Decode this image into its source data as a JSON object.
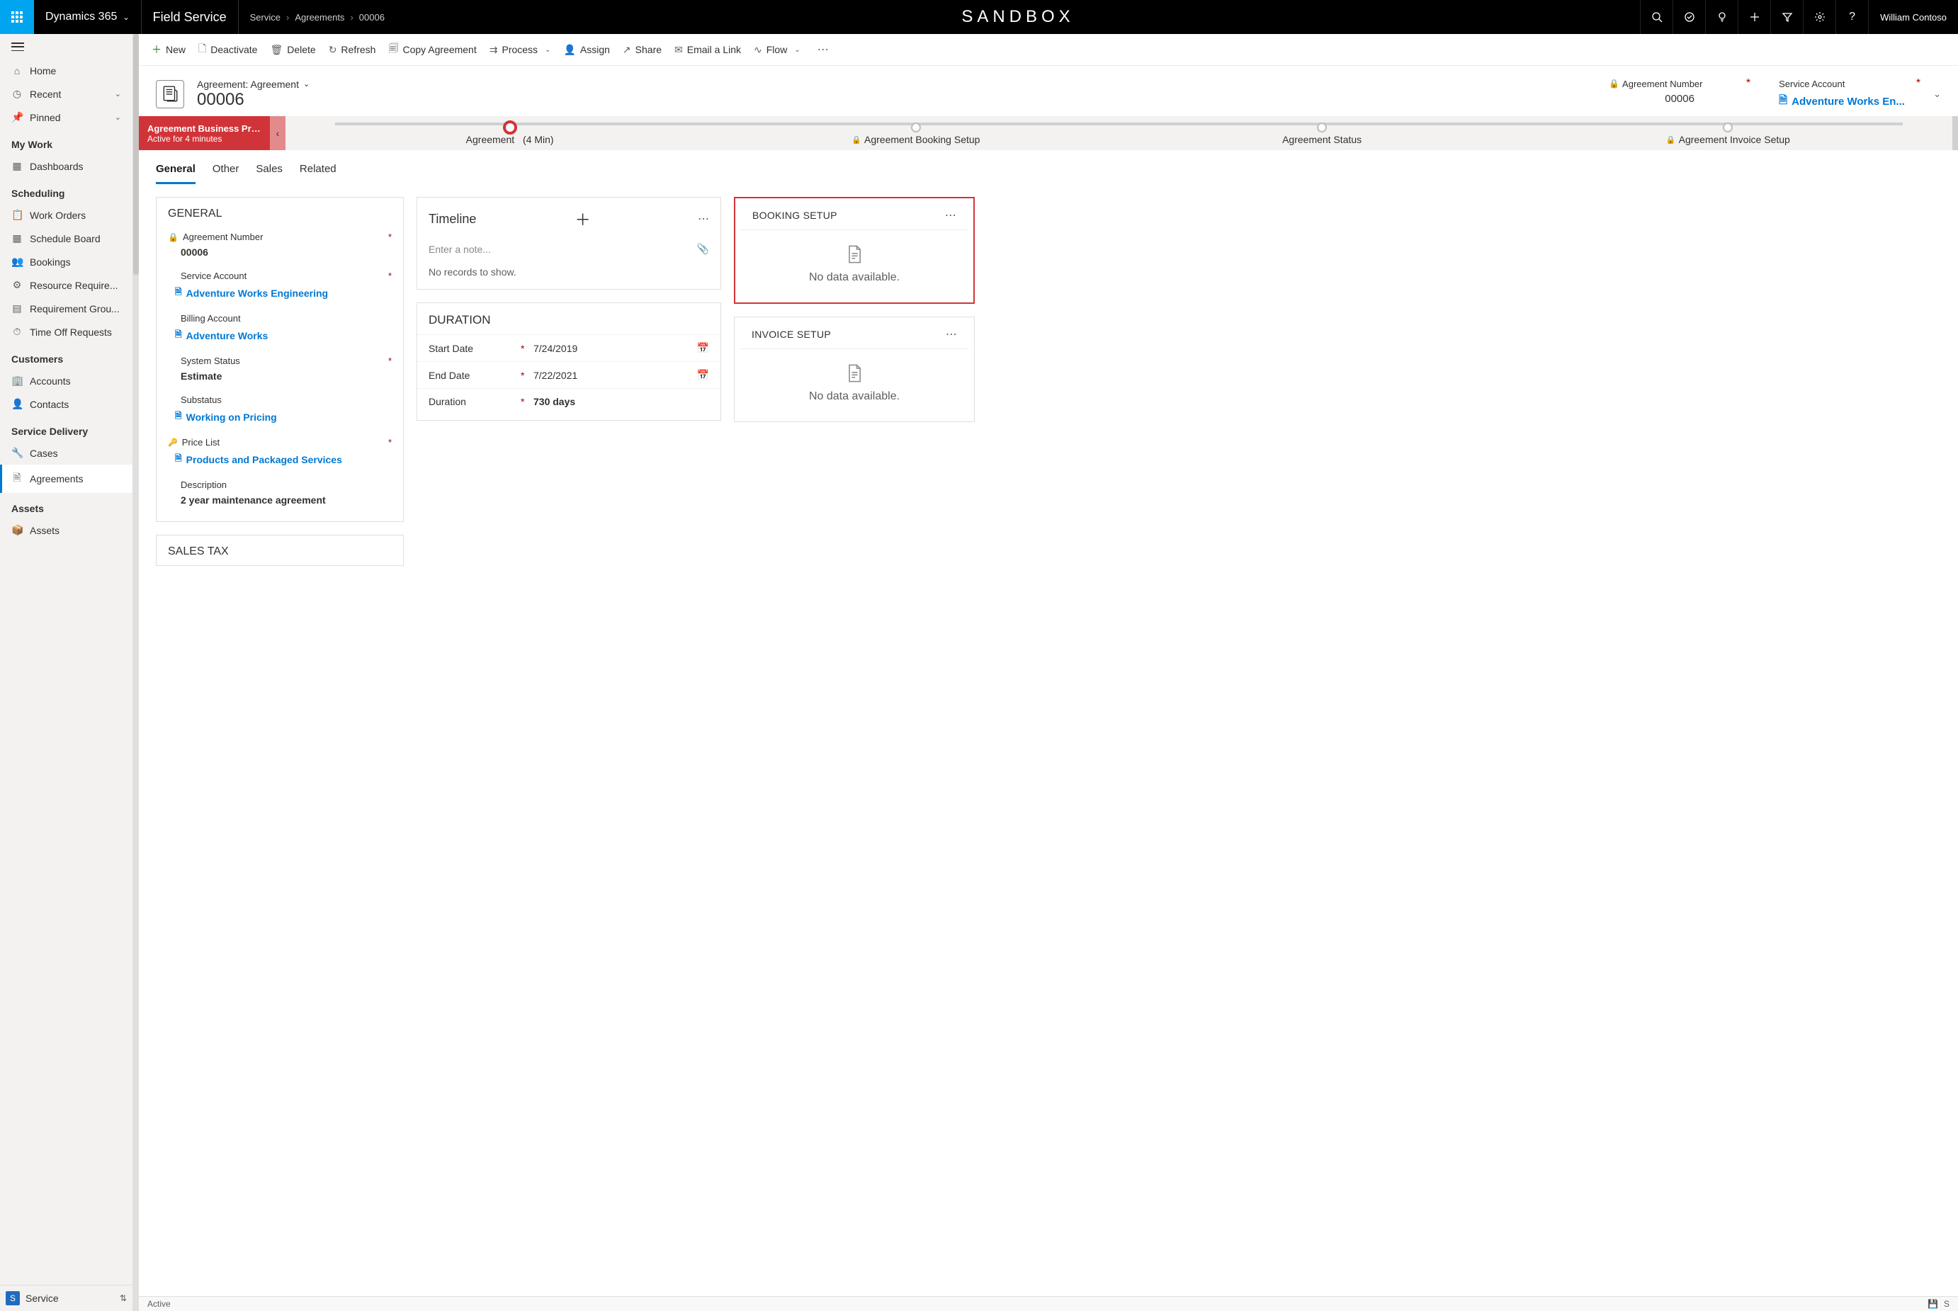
{
  "topbar": {
    "brand": "Dynamics 365",
    "area": "Field Service",
    "crumbs": [
      "Service",
      "Agreements",
      "00006"
    ],
    "sandbox": "SANDBOX",
    "user": "William Contoso"
  },
  "sidebar": {
    "items": [
      {
        "icon": "home",
        "label": "Home"
      },
      {
        "icon": "clock",
        "label": "Recent",
        "chev": true
      },
      {
        "icon": "pin",
        "label": "Pinned",
        "chev": true
      }
    ],
    "groups": [
      {
        "title": "My Work",
        "items": [
          {
            "icon": "dash",
            "label": "Dashboards"
          }
        ]
      },
      {
        "title": "Scheduling",
        "items": [
          {
            "icon": "clip",
            "label": "Work Orders"
          },
          {
            "icon": "cal",
            "label": "Schedule Board"
          },
          {
            "icon": "people",
            "label": "Bookings"
          },
          {
            "icon": "gear",
            "label": "Resource Require..."
          },
          {
            "icon": "grid",
            "label": "Requirement Grou..."
          },
          {
            "icon": "timeoff",
            "label": "Time Off Requests"
          }
        ]
      },
      {
        "title": "Customers",
        "items": [
          {
            "icon": "building",
            "label": "Accounts"
          },
          {
            "icon": "person",
            "label": "Contacts"
          }
        ]
      },
      {
        "title": "Service Delivery",
        "items": [
          {
            "icon": "wrench",
            "label": "Cases"
          },
          {
            "icon": "doc",
            "label": "Agreements",
            "active": true
          }
        ]
      },
      {
        "title": "Assets",
        "items": [
          {
            "icon": "cube",
            "label": "Assets"
          }
        ]
      }
    ],
    "area": {
      "letter": "S",
      "label": "Service"
    }
  },
  "cmdbar": [
    {
      "icon": "plus",
      "label": "New",
      "green": true
    },
    {
      "icon": "deact",
      "label": "Deactivate"
    },
    {
      "icon": "trash",
      "label": "Delete"
    },
    {
      "icon": "refresh",
      "label": "Refresh"
    },
    {
      "icon": "copy",
      "label": "Copy Agreement"
    },
    {
      "icon": "process",
      "label": "Process",
      "chev": true
    },
    {
      "icon": "assign",
      "label": "Assign"
    },
    {
      "icon": "share",
      "label": "Share"
    },
    {
      "icon": "email",
      "label": "Email a Link"
    },
    {
      "icon": "flow",
      "label": "Flow",
      "chev": true
    }
  ],
  "header": {
    "type": "Agreement: Agreement",
    "title": "00006",
    "fields": [
      {
        "label": "Agreement Number",
        "value": "00006",
        "lock": true,
        "req": true
      },
      {
        "label": "Service Account",
        "value": "Adventure Works En...",
        "link": true,
        "req": true
      }
    ]
  },
  "stagebar": {
    "name": "Agreement Business Pro...",
    "sub": "Active for 4 minutes",
    "stages": [
      {
        "label": "Agreement",
        "time": "(4 Min)",
        "active": true
      },
      {
        "label": "Agreement Booking Setup",
        "lock": true
      },
      {
        "label": "Agreement Status"
      },
      {
        "label": "Agreement Invoice Setup",
        "lock": true
      }
    ]
  },
  "tabs": [
    "General",
    "Other",
    "Sales",
    "Related"
  ],
  "general": {
    "title": "GENERAL",
    "rows": [
      {
        "label": "Agreement Number",
        "value": "00006",
        "lock": true,
        "req": true
      },
      {
        "label": "Service Account",
        "value": "Adventure Works Engineering",
        "link": true,
        "req": true
      },
      {
        "label": "Billing Account",
        "value": "Adventure Works",
        "link": true
      },
      {
        "label": "System Status",
        "value": "Estimate",
        "req": true
      },
      {
        "label": "Substatus",
        "value": "Working on Pricing",
        "link": true,
        "docicon": true
      },
      {
        "label": "Price List",
        "value": "Products and Packaged Services",
        "link": true,
        "key": true,
        "req": true,
        "docicon": true
      },
      {
        "label": "Description",
        "value": "2 year maintenance agreement"
      }
    ]
  },
  "salestax": {
    "title": "SALES TAX"
  },
  "timeline": {
    "title": "Timeline",
    "placeholder": "Enter a note...",
    "empty": "No records to show."
  },
  "duration": {
    "title": "DURATION",
    "rows": [
      {
        "label": "Start Date",
        "value": "7/24/2019",
        "req": true,
        "cal": true
      },
      {
        "label": "End Date",
        "value": "7/22/2021",
        "req": true,
        "cal": true
      },
      {
        "label": "Duration",
        "value": "730 days",
        "req": true,
        "bold": true
      }
    ]
  },
  "booking": {
    "title": "BOOKING SETUP",
    "empty": "No data available."
  },
  "invoice": {
    "title": "INVOICE SETUP",
    "empty": "No data available."
  },
  "bottom": {
    "status": "Active",
    "save": "S"
  }
}
